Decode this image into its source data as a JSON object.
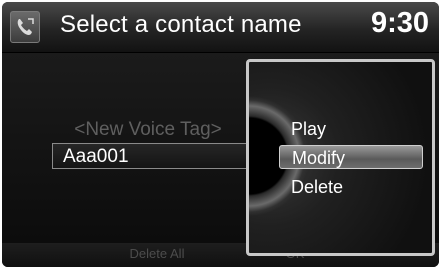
{
  "header": {
    "title": "Select a contact name",
    "time": "9:30",
    "icon": "phone-settings-icon"
  },
  "contacts": {
    "items": [
      {
        "label": "<New Voice Tag>",
        "enabled": false
      },
      {
        "label": "Aaa001",
        "selected": true
      }
    ]
  },
  "bottom_bar": {
    "delete_all_label": "Delete All",
    "ok_label": "OK"
  },
  "popup_menu": {
    "items": [
      {
        "label": "Play"
      },
      {
        "label": "Modify",
        "highlighted": true
      },
      {
        "label": "Delete"
      }
    ]
  }
}
